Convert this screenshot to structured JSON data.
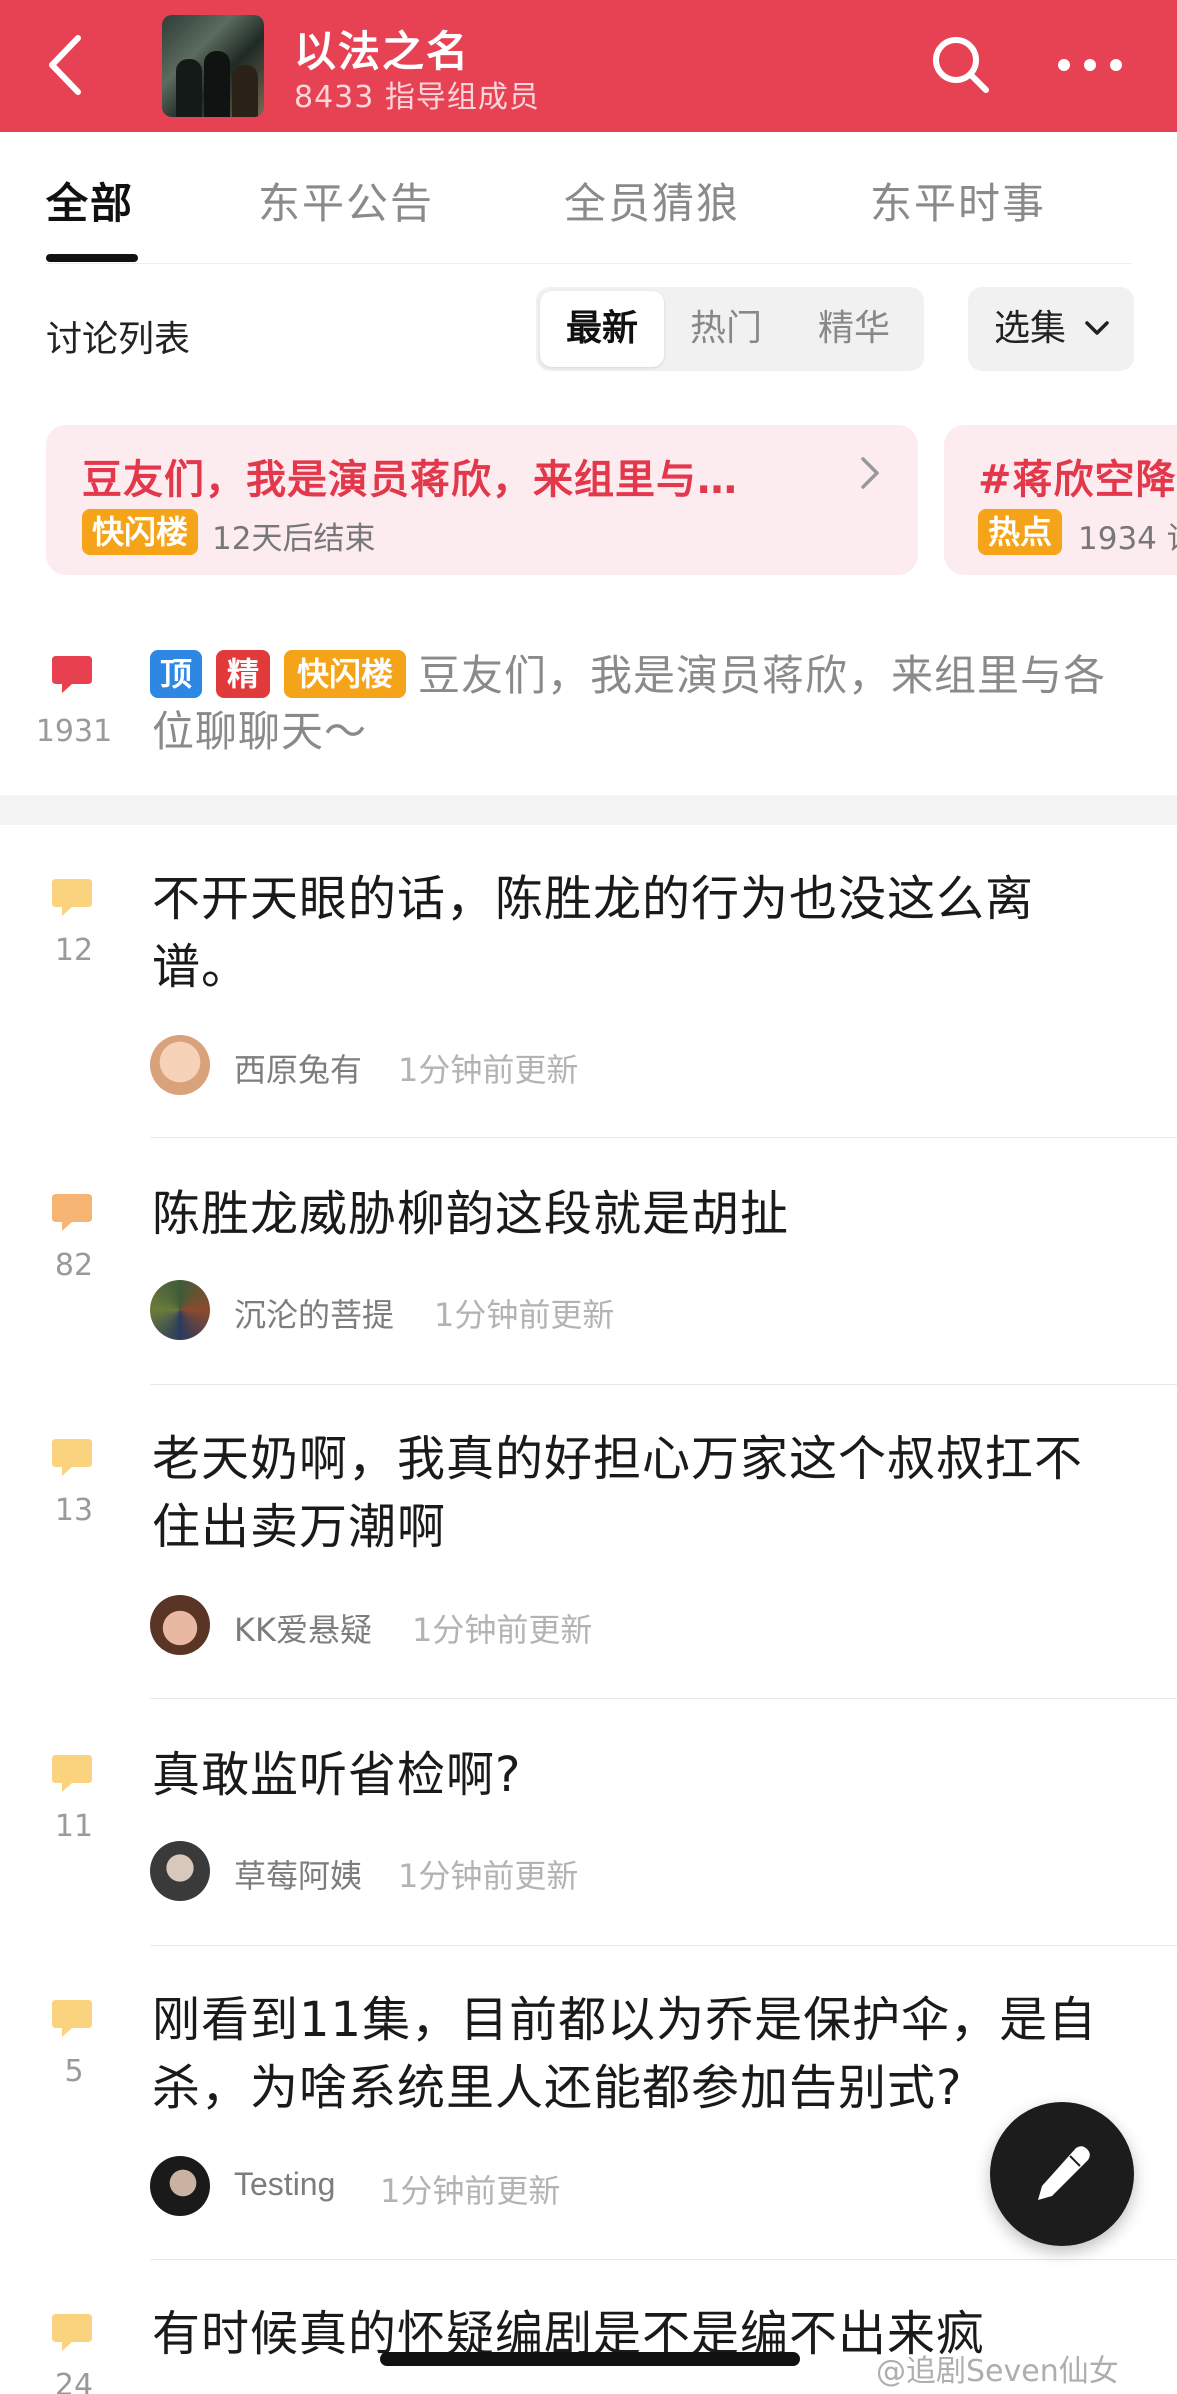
{
  "header": {
    "title": "以法之名",
    "member_count": "8433 指导组成员",
    "bg_color": "#e64253",
    "back_icon": "chevron-left-icon",
    "search_icon": "search-icon",
    "more_icon": "more-horizontal-icon"
  },
  "tabs": [
    {
      "label": "全部",
      "active": true
    },
    {
      "label": "东平公告",
      "active": false
    },
    {
      "label": "全员猜狼",
      "active": false
    },
    {
      "label": "东平时事",
      "active": false
    }
  ],
  "discussion": {
    "label": "讨论列表",
    "sort_options": [
      {
        "label": "最新",
        "active": true
      },
      {
        "label": "热门",
        "active": false
      },
      {
        "label": "精华",
        "active": false
      }
    ],
    "episode_select": "选集"
  },
  "banners": [
    {
      "title": "豆友们，我是演员蒋欣，来组里与…",
      "tag": "快闪楼",
      "meta": "12天后结束"
    },
    {
      "title": "#蒋欣空降",
      "tag": "热点",
      "meta": "1934 讨"
    }
  ],
  "pinned_post": {
    "comment_count": "1931",
    "badges": [
      "顶",
      "精",
      "快闪楼"
    ],
    "title": "豆友们，我是演员蒋欣，来组里与各位聊聊天～",
    "bubble_color": "#e8404e"
  },
  "posts": [
    {
      "comment_count": "12",
      "title": "不开天眼的话，陈胜龙的行为也没这么离谱。",
      "author": "西原兔有",
      "updated": "1分钟前更新",
      "bubble_color": "#fbd27d"
    },
    {
      "comment_count": "82",
      "title": "陈胜龙威胁柳韵这段就是胡扯",
      "author": "沉沦的菩提",
      "updated": "1分钟前更新",
      "bubble_color": "#f7b574"
    },
    {
      "comment_count": "13",
      "title": "老天奶啊，我真的好担心万家这个叔叔扛不住出卖万潮啊",
      "author": "KK爱悬疑",
      "updated": "1分钟前更新",
      "bubble_color": "#fbd27d"
    },
    {
      "comment_count": "11",
      "title": "真敢监听省检啊?",
      "author": "草莓阿姨",
      "updated": "1分钟前更新",
      "bubble_color": "#fbd27d"
    },
    {
      "comment_count": "5",
      "title": "刚看到11集，目前都以为乔是保护伞，是自杀，为啥系统里人还能都参加告别式?",
      "author": "Testing",
      "updated": "1分钟前更新",
      "bubble_color": "#fbd27d"
    },
    {
      "comment_count": "24",
      "title": "有时候真的怀疑编剧是不是编不出来疯",
      "author": "",
      "updated": "",
      "bubble_color": "#fbd27d"
    }
  ],
  "fab": {
    "icon": "pen-icon"
  },
  "watermark": "@追剧Seven仙女"
}
